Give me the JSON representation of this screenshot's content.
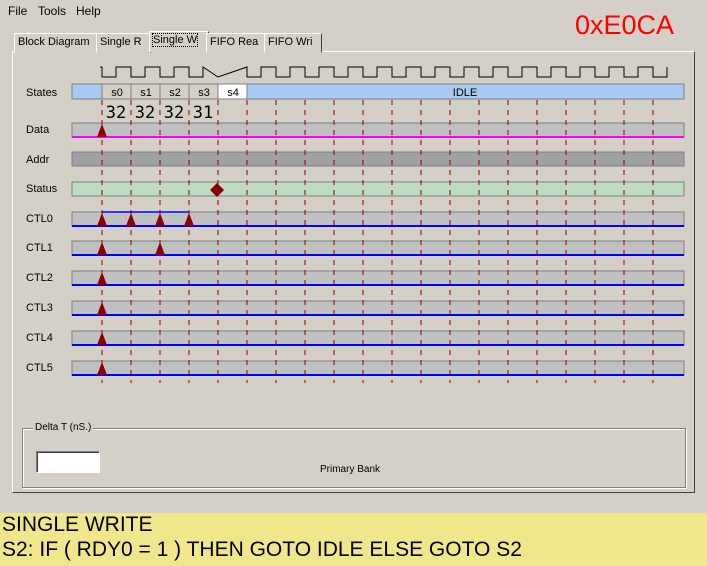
{
  "menu": [
    {
      "label": "File"
    },
    {
      "label": "Tools"
    },
    {
      "label": "Help"
    }
  ],
  "hex_value": "0xE0CA",
  "tabs": [
    {
      "label": "Block Diagram",
      "active": false
    },
    {
      "label": "Single R",
      "active": false
    },
    {
      "label": "Single W",
      "active": true
    },
    {
      "label": "FIFO Rea",
      "active": false
    },
    {
      "label": "FIFO Wri",
      "active": false
    }
  ],
  "timing": {
    "states": [
      "s0",
      "s1",
      "s2",
      "s3",
      "s4"
    ],
    "idle_label": "IDLE",
    "counts": [
      "32",
      "32",
      "32",
      "31"
    ],
    "signals": [
      "States",
      "Data",
      "Addr",
      "Status",
      "CTL0",
      "CTL1",
      "CTL2",
      "CTL3",
      "CTL4",
      "CTL5"
    ],
    "colors": {
      "state_fill": "#a6caf0",
      "data_line": "#ff00ff",
      "ctl_line": "#0000ff",
      "addr_fill": "#a0a0a4",
      "status_fill": "#c0dcc0",
      "marker": "#8b0000",
      "tick": "#8b0000"
    }
  },
  "delta_t": {
    "label": "Delta T (nS.)",
    "value": ""
  },
  "bank_label": "Primary Bank",
  "status_bar": {
    "line1": "SINGLE WRITE",
    "line2": "S2: IF ( RDY0 = 1 ) THEN GOTO IDLE ELSE GOTO S2",
    "background": "#f0e68c"
  }
}
